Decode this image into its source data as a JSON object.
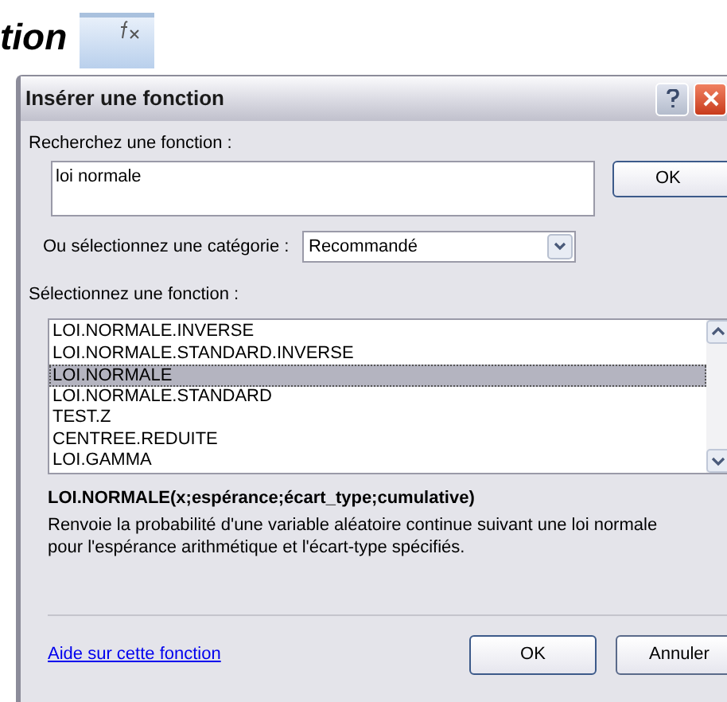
{
  "heading": {
    "text": "tion"
  },
  "dialog": {
    "title": "Insérer une fonction",
    "search": {
      "label": "Recherchez une fonction :",
      "value": "loi normale",
      "button": "OK"
    },
    "category": {
      "label": "Ou sélectionnez une catégorie :",
      "value": "Recommandé"
    },
    "list": {
      "label": "Sélectionnez une fonction :",
      "items": [
        {
          "text": "LOI.NORMALE.INVERSE",
          "selected": false
        },
        {
          "text": "LOI.NORMALE.STANDARD.INVERSE",
          "selected": false
        },
        {
          "text": "LOI.NORMALE",
          "selected": true
        },
        {
          "text": "LOI.NORMALE.STANDARD",
          "selected": false
        },
        {
          "text": "TEST.Z",
          "selected": false
        },
        {
          "text": "CENTREE.REDUITE",
          "selected": false
        },
        {
          "text": "LOI.GAMMA",
          "selected": false
        }
      ]
    },
    "signature": "LOI.NORMALE(x;espérance;écart_type;cumulative)",
    "description": "Renvoie la probabilité d'une variable aléatoire continue suivant une loi normale pour l'espérance arithmétique et l'écart-type spécifiés.",
    "help_link": "Aide sur cette fonction",
    "buttons": [
      "OK",
      "Annuler"
    ]
  }
}
